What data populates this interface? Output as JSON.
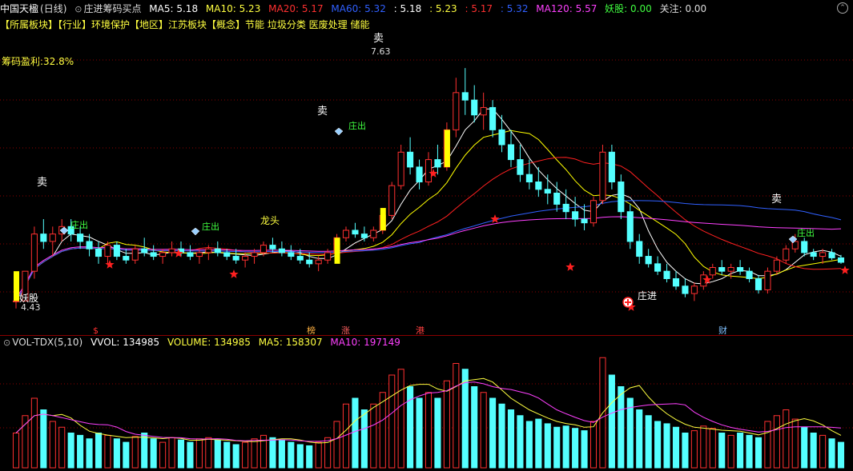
{
  "header": {
    "stock_name": "中国天楹",
    "period": "(日线)",
    "indicator_name": "庄进筹码买点",
    "ma5_label": "MA5:",
    "ma5_value": "5.18",
    "ma10_label": "MA10:",
    "ma10_value": "5.23",
    "ma20_label": "MA20:",
    "ma20_value": "5.17",
    "ma60_label": "MA60:",
    "ma60_value": "5.32",
    "extra1": ": 5.18",
    "extra2": ": 5.23",
    "extra3": ": 5.17",
    "extra4": ": 5.32",
    "ma120_label": "MA120:",
    "ma120_value": "5.57",
    "yaogu_label": "妖股:",
    "yaogu_value": "0.00",
    "guanzhu_label": "关注:",
    "guanzhu_value": "0.00"
  },
  "sector_text": "【所属板块】【行业】环境保护【地区】江苏板块【概念】节能 垃圾分类 医废处理 储能",
  "profit_label": "筹码盈利:32.8%",
  "annotations": {
    "sell": "卖",
    "high_price": "7.63",
    "low_price": "4.43",
    "yaogu": "妖股",
    "zhuangjin": "庄进",
    "zhuangchu": "庄出",
    "longtou": "龙头"
  },
  "event_markers": [
    {
      "label": "$",
      "color": "#ff3030"
    },
    {
      "label": "榜",
      "color": "#ffb040"
    },
    {
      "label": "涨",
      "color": "#ff6060"
    },
    {
      "label": "港",
      "color": "#ff4040"
    },
    {
      "label": "财",
      "color": "#80c0ff"
    }
  ],
  "volume_header": {
    "name": "VOL-TDX(5,10)",
    "vvol_label": "VVOL:",
    "vvol_value": "134985",
    "volume_label": "VOLUME:",
    "volume_value": "134985",
    "ma5_label": "MA5:",
    "ma5_value": "158307",
    "ma10_label": "MA10:",
    "ma10_value": "197149"
  },
  "colors": {
    "up": "#ff3030",
    "down": "#54ffff",
    "ma5": "#ffffff",
    "ma10": "#ffff00",
    "ma20": "#ff2020",
    "ma60": "#3060ff",
    "ma120": "#ff40ff",
    "grid": "#8b0000"
  },
  "chart_data": {
    "type": "candlestick",
    "price_range": [
      4.3,
      7.9
    ],
    "ohlc": [
      [
        4.5,
        4.6,
        4.4,
        4.5
      ],
      [
        4.5,
        4.9,
        4.5,
        4.9
      ],
      [
        4.9,
        5.5,
        4.8,
        5.4
      ],
      [
        5.4,
        5.6,
        5.2,
        5.3
      ],
      [
        5.3,
        5.5,
        5.1,
        5.4
      ],
      [
        5.4,
        5.6,
        5.3,
        5.5
      ],
      [
        5.5,
        5.6,
        5.3,
        5.4
      ],
      [
        5.4,
        5.5,
        5.2,
        5.3
      ],
      [
        5.3,
        5.4,
        5.1,
        5.2
      ],
      [
        5.2,
        5.3,
        5.0,
        5.1
      ],
      [
        5.1,
        5.3,
        5.0,
        5.25
      ],
      [
        5.25,
        5.3,
        5.05,
        5.1
      ],
      [
        5.1,
        5.2,
        5.0,
        5.05
      ],
      [
        5.05,
        5.25,
        5.0,
        5.2
      ],
      [
        5.2,
        5.35,
        5.1,
        5.15
      ],
      [
        5.15,
        5.25,
        5.05,
        5.1
      ],
      [
        5.1,
        5.2,
        5.0,
        5.15
      ],
      [
        5.15,
        5.3,
        5.1,
        5.2
      ],
      [
        5.2,
        5.3,
        5.1,
        5.15
      ],
      [
        5.15,
        5.25,
        5.05,
        5.1
      ],
      [
        5.1,
        5.2,
        5.0,
        5.15
      ],
      [
        5.15,
        5.25,
        5.05,
        5.2
      ],
      [
        5.2,
        5.3,
        5.1,
        5.15
      ],
      [
        5.15,
        5.2,
        5.05,
        5.1
      ],
      [
        5.1,
        5.2,
        5.0,
        5.05
      ],
      [
        5.05,
        5.15,
        4.95,
        5.1
      ],
      [
        5.1,
        5.2,
        5.0,
        5.15
      ],
      [
        5.15,
        5.3,
        5.1,
        5.25
      ],
      [
        5.25,
        5.35,
        5.15,
        5.2
      ],
      [
        5.2,
        5.3,
        5.1,
        5.15
      ],
      [
        5.15,
        5.25,
        5.05,
        5.1
      ],
      [
        5.1,
        5.2,
        5.0,
        5.05
      ],
      [
        5.05,
        5.15,
        4.95,
        5.0
      ],
      [
        5.0,
        5.1,
        4.9,
        5.05
      ],
      [
        5.05,
        5.2,
        5.0,
        5.15
      ],
      [
        5.15,
        5.4,
        5.1,
        5.35
      ],
      [
        5.35,
        5.5,
        5.3,
        5.45
      ],
      [
        5.45,
        5.55,
        5.35,
        5.4
      ],
      [
        5.4,
        5.5,
        5.3,
        5.35
      ],
      [
        5.35,
        5.5,
        5.3,
        5.45
      ],
      [
        5.45,
        5.7,
        5.4,
        5.65
      ],
      [
        5.65,
        6.1,
        5.6,
        6.05
      ],
      [
        6.05,
        6.6,
        6.0,
        6.5
      ],
      [
        6.5,
        6.7,
        6.2,
        6.3
      ],
      [
        6.3,
        6.4,
        6.0,
        6.1
      ],
      [
        6.1,
        6.5,
        6.05,
        6.4
      ],
      [
        6.4,
        6.6,
        6.2,
        6.3
      ],
      [
        6.3,
        6.9,
        6.25,
        6.8
      ],
      [
        6.8,
        7.5,
        6.7,
        7.3
      ],
      [
        7.3,
        7.63,
        7.0,
        7.2
      ],
      [
        7.2,
        7.4,
        6.9,
        7.0
      ],
      [
        7.0,
        7.3,
        6.8,
        7.1
      ],
      [
        7.1,
        7.2,
        6.7,
        6.8
      ],
      [
        6.8,
        7.0,
        6.5,
        6.6
      ],
      [
        6.6,
        6.8,
        6.3,
        6.4
      ],
      [
        6.4,
        6.6,
        6.1,
        6.2
      ],
      [
        6.2,
        6.4,
        6.0,
        6.1
      ],
      [
        6.1,
        6.3,
        5.9,
        6.0
      ],
      [
        6.0,
        6.2,
        5.8,
        5.95
      ],
      [
        5.95,
        6.1,
        5.7,
        5.8
      ],
      [
        5.8,
        6.0,
        5.6,
        5.7
      ],
      [
        5.7,
        5.9,
        5.5,
        5.6
      ],
      [
        5.6,
        5.8,
        5.45,
        5.55
      ],
      [
        5.55,
        5.9,
        5.5,
        5.85
      ],
      [
        5.85,
        6.6,
        5.8,
        6.5
      ],
      [
        6.5,
        6.6,
        6.0,
        6.1
      ],
      [
        6.1,
        6.2,
        5.6,
        5.7
      ],
      [
        5.7,
        5.8,
        5.2,
        5.3
      ],
      [
        5.3,
        5.4,
        5.0,
        5.1
      ],
      [
        5.1,
        5.2,
        4.95,
        5.0
      ],
      [
        5.0,
        5.1,
        4.85,
        4.9
      ],
      [
        4.9,
        5.0,
        4.75,
        4.8
      ],
      [
        4.8,
        4.9,
        4.65,
        4.7
      ],
      [
        4.7,
        4.8,
        4.55,
        4.6
      ],
      [
        4.6,
        4.75,
        4.5,
        4.7
      ],
      [
        4.7,
        4.9,
        4.65,
        4.85
      ],
      [
        4.85,
        5.0,
        4.8,
        4.95
      ],
      [
        4.95,
        5.05,
        4.85,
        4.9
      ],
      [
        4.9,
        5.0,
        4.8,
        4.95
      ],
      [
        4.95,
        5.05,
        4.85,
        4.9
      ],
      [
        4.9,
        4.95,
        4.75,
        4.8
      ],
      [
        4.8,
        4.85,
        4.6,
        4.65
      ],
      [
        4.65,
        4.95,
        4.6,
        4.9
      ],
      [
        4.9,
        5.1,
        4.85,
        5.05
      ],
      [
        5.05,
        5.25,
        5.0,
        5.2
      ],
      [
        5.2,
        5.4,
        5.15,
        5.3
      ],
      [
        5.3,
        5.35,
        5.1,
        5.15
      ],
      [
        5.15,
        5.2,
        5.05,
        5.1
      ],
      [
        5.1,
        5.2,
        5.0,
        5.15
      ],
      [
        5.15,
        5.2,
        5.05,
        5.08
      ],
      [
        5.08,
        5.12,
        5.0,
        5.02
      ]
    ],
    "volume": [
      30,
      45,
      60,
      50,
      40,
      35,
      30,
      28,
      25,
      30,
      28,
      25,
      22,
      27,
      30,
      25,
      22,
      26,
      24,
      22,
      25,
      26,
      24,
      22,
      20,
      22,
      25,
      28,
      26,
      24,
      22,
      20,
      19,
      22,
      26,
      40,
      55,
      60,
      50,
      55,
      65,
      80,
      85,
      70,
      60,
      65,
      60,
      75,
      90,
      85,
      70,
      65,
      60,
      55,
      50,
      45,
      40,
      42,
      38,
      35,
      36,
      34,
      32,
      40,
      95,
      80,
      70,
      60,
      50,
      45,
      40,
      38,
      35,
      30,
      32,
      36,
      34,
      30,
      28,
      30,
      28,
      26,
      40,
      45,
      50,
      42,
      35,
      30,
      28,
      25,
      22
    ]
  }
}
